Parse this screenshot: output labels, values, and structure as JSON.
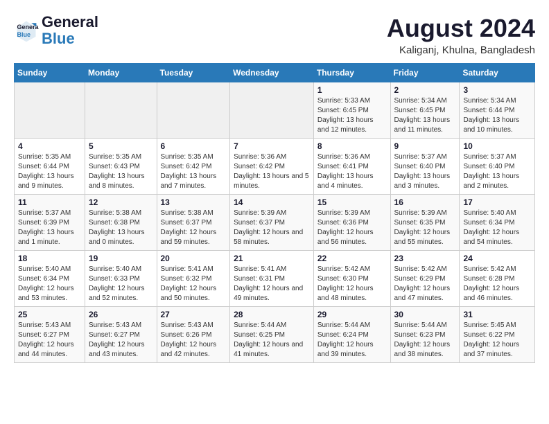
{
  "header": {
    "logo_line1": "General",
    "logo_line2": "Blue",
    "title": "August 2024",
    "subtitle": "Kaliganj, Khulna, Bangladesh"
  },
  "calendar": {
    "days_of_week": [
      "Sunday",
      "Monday",
      "Tuesday",
      "Wednesday",
      "Thursday",
      "Friday",
      "Saturday"
    ],
    "weeks": [
      [
        {
          "day": "",
          "info": ""
        },
        {
          "day": "",
          "info": ""
        },
        {
          "day": "",
          "info": ""
        },
        {
          "day": "",
          "info": ""
        },
        {
          "day": "1",
          "info": "Sunrise: 5:33 AM\nSunset: 6:45 PM\nDaylight: 13 hours\nand 12 minutes."
        },
        {
          "day": "2",
          "info": "Sunrise: 5:34 AM\nSunset: 6:45 PM\nDaylight: 13 hours\nand 11 minutes."
        },
        {
          "day": "3",
          "info": "Sunrise: 5:34 AM\nSunset: 6:44 PM\nDaylight: 13 hours\nand 10 minutes."
        }
      ],
      [
        {
          "day": "4",
          "info": "Sunrise: 5:35 AM\nSunset: 6:44 PM\nDaylight: 13 hours\nand 9 minutes."
        },
        {
          "day": "5",
          "info": "Sunrise: 5:35 AM\nSunset: 6:43 PM\nDaylight: 13 hours\nand 8 minutes."
        },
        {
          "day": "6",
          "info": "Sunrise: 5:35 AM\nSunset: 6:42 PM\nDaylight: 13 hours\nand 7 minutes."
        },
        {
          "day": "7",
          "info": "Sunrise: 5:36 AM\nSunset: 6:42 PM\nDaylight: 13 hours\nand 5 minutes."
        },
        {
          "day": "8",
          "info": "Sunrise: 5:36 AM\nSunset: 6:41 PM\nDaylight: 13 hours\nand 4 minutes."
        },
        {
          "day": "9",
          "info": "Sunrise: 5:37 AM\nSunset: 6:40 PM\nDaylight: 13 hours\nand 3 minutes."
        },
        {
          "day": "10",
          "info": "Sunrise: 5:37 AM\nSunset: 6:40 PM\nDaylight: 13 hours\nand 2 minutes."
        }
      ],
      [
        {
          "day": "11",
          "info": "Sunrise: 5:37 AM\nSunset: 6:39 PM\nDaylight: 13 hours\nand 1 minute."
        },
        {
          "day": "12",
          "info": "Sunrise: 5:38 AM\nSunset: 6:38 PM\nDaylight: 13 hours\nand 0 minutes."
        },
        {
          "day": "13",
          "info": "Sunrise: 5:38 AM\nSunset: 6:37 PM\nDaylight: 12 hours\nand 59 minutes."
        },
        {
          "day": "14",
          "info": "Sunrise: 5:39 AM\nSunset: 6:37 PM\nDaylight: 12 hours\nand 58 minutes."
        },
        {
          "day": "15",
          "info": "Sunrise: 5:39 AM\nSunset: 6:36 PM\nDaylight: 12 hours\nand 56 minutes."
        },
        {
          "day": "16",
          "info": "Sunrise: 5:39 AM\nSunset: 6:35 PM\nDaylight: 12 hours\nand 55 minutes."
        },
        {
          "day": "17",
          "info": "Sunrise: 5:40 AM\nSunset: 6:34 PM\nDaylight: 12 hours\nand 54 minutes."
        }
      ],
      [
        {
          "day": "18",
          "info": "Sunrise: 5:40 AM\nSunset: 6:34 PM\nDaylight: 12 hours\nand 53 minutes."
        },
        {
          "day": "19",
          "info": "Sunrise: 5:40 AM\nSunset: 6:33 PM\nDaylight: 12 hours\nand 52 minutes."
        },
        {
          "day": "20",
          "info": "Sunrise: 5:41 AM\nSunset: 6:32 PM\nDaylight: 12 hours\nand 50 minutes."
        },
        {
          "day": "21",
          "info": "Sunrise: 5:41 AM\nSunset: 6:31 PM\nDaylight: 12 hours\nand 49 minutes."
        },
        {
          "day": "22",
          "info": "Sunrise: 5:42 AM\nSunset: 6:30 PM\nDaylight: 12 hours\nand 48 minutes."
        },
        {
          "day": "23",
          "info": "Sunrise: 5:42 AM\nSunset: 6:29 PM\nDaylight: 12 hours\nand 47 minutes."
        },
        {
          "day": "24",
          "info": "Sunrise: 5:42 AM\nSunset: 6:28 PM\nDaylight: 12 hours\nand 46 minutes."
        }
      ],
      [
        {
          "day": "25",
          "info": "Sunrise: 5:43 AM\nSunset: 6:27 PM\nDaylight: 12 hours\nand 44 minutes."
        },
        {
          "day": "26",
          "info": "Sunrise: 5:43 AM\nSunset: 6:27 PM\nDaylight: 12 hours\nand 43 minutes."
        },
        {
          "day": "27",
          "info": "Sunrise: 5:43 AM\nSunset: 6:26 PM\nDaylight: 12 hours\nand 42 minutes."
        },
        {
          "day": "28",
          "info": "Sunrise: 5:44 AM\nSunset: 6:25 PM\nDaylight: 12 hours\nand 41 minutes."
        },
        {
          "day": "29",
          "info": "Sunrise: 5:44 AM\nSunset: 6:24 PM\nDaylight: 12 hours\nand 39 minutes."
        },
        {
          "day": "30",
          "info": "Sunrise: 5:44 AM\nSunset: 6:23 PM\nDaylight: 12 hours\nand 38 minutes."
        },
        {
          "day": "31",
          "info": "Sunrise: 5:45 AM\nSunset: 6:22 PM\nDaylight: 12 hours\nand 37 minutes."
        }
      ]
    ]
  }
}
